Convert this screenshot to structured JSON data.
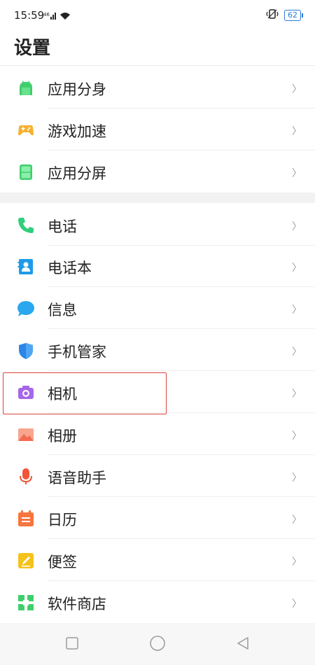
{
  "status_bar": {
    "time": "15:59",
    "signal_text": "⁴⁶ıll",
    "battery": "62"
  },
  "page": {
    "title": "设置"
  },
  "settings_items": [
    {
      "label": "应用分身",
      "icon": "android-clone-icon",
      "color": "#3ecf6b"
    },
    {
      "label": "游戏加速",
      "icon": "gamepad-icon",
      "color": "#f6b132"
    },
    {
      "label": "应用分屏",
      "icon": "split-screen-icon",
      "color": "#3ecf6b"
    },
    {
      "label": "电话",
      "icon": "phone-icon",
      "color": "#2fcf7a"
    },
    {
      "label": "电话本",
      "icon": "contacts-icon",
      "color": "#1e9be8"
    },
    {
      "label": "信息",
      "icon": "message-icon",
      "color": "#2aa7ee"
    },
    {
      "label": "手机管家",
      "icon": "shield-icon",
      "color": "#2a86e8"
    },
    {
      "label": "相机",
      "icon": "camera-icon",
      "color": "#a666e8"
    },
    {
      "label": "相册",
      "icon": "gallery-icon",
      "color": "#f36b52"
    },
    {
      "label": "语音助手",
      "icon": "microphone-icon",
      "color": "#f2563a"
    },
    {
      "label": "日历",
      "icon": "calendar-icon",
      "color": "#f5763e"
    },
    {
      "label": "便签",
      "icon": "notes-icon",
      "color": "#f5c21b"
    },
    {
      "label": "软件商店",
      "icon": "app-store-icon",
      "color": "#3ecf6b"
    }
  ],
  "chevron": "〉",
  "highlight": {
    "item": "相机",
    "color": "#d9433a"
  },
  "navigation": {
    "buttons": [
      "recent-apps-button",
      "home-button",
      "back-button"
    ]
  }
}
